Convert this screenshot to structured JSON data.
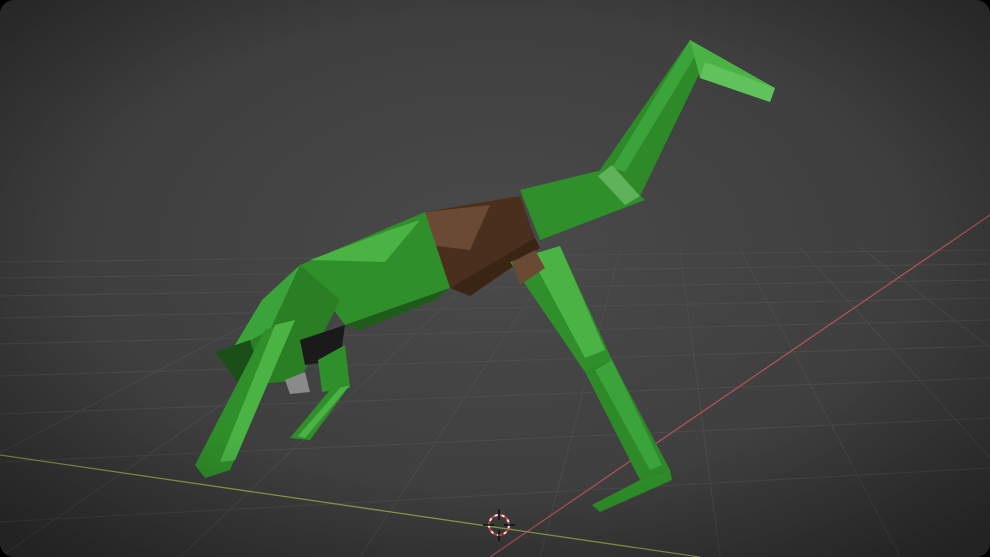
{
  "viewport": {
    "mode": "3d-viewport",
    "background_color": "#3d3d3d",
    "grid_color": "#4d4d4d",
    "x_axis_color": "#b0505a",
    "y_axis_color": "#8aa24a",
    "cursor_icon": "3d-cursor-icon"
  },
  "model": {
    "name_visible": false,
    "shading": "solid-flat",
    "colors": {
      "body_green": "#2f8f2a",
      "body_green_light": "#4bb344",
      "body_green_dark": "#1f5c1b",
      "band_brown": "#4a2f1c",
      "band_brown_light": "#6a4a35",
      "joint_gray": "#8a8a8a"
    }
  }
}
